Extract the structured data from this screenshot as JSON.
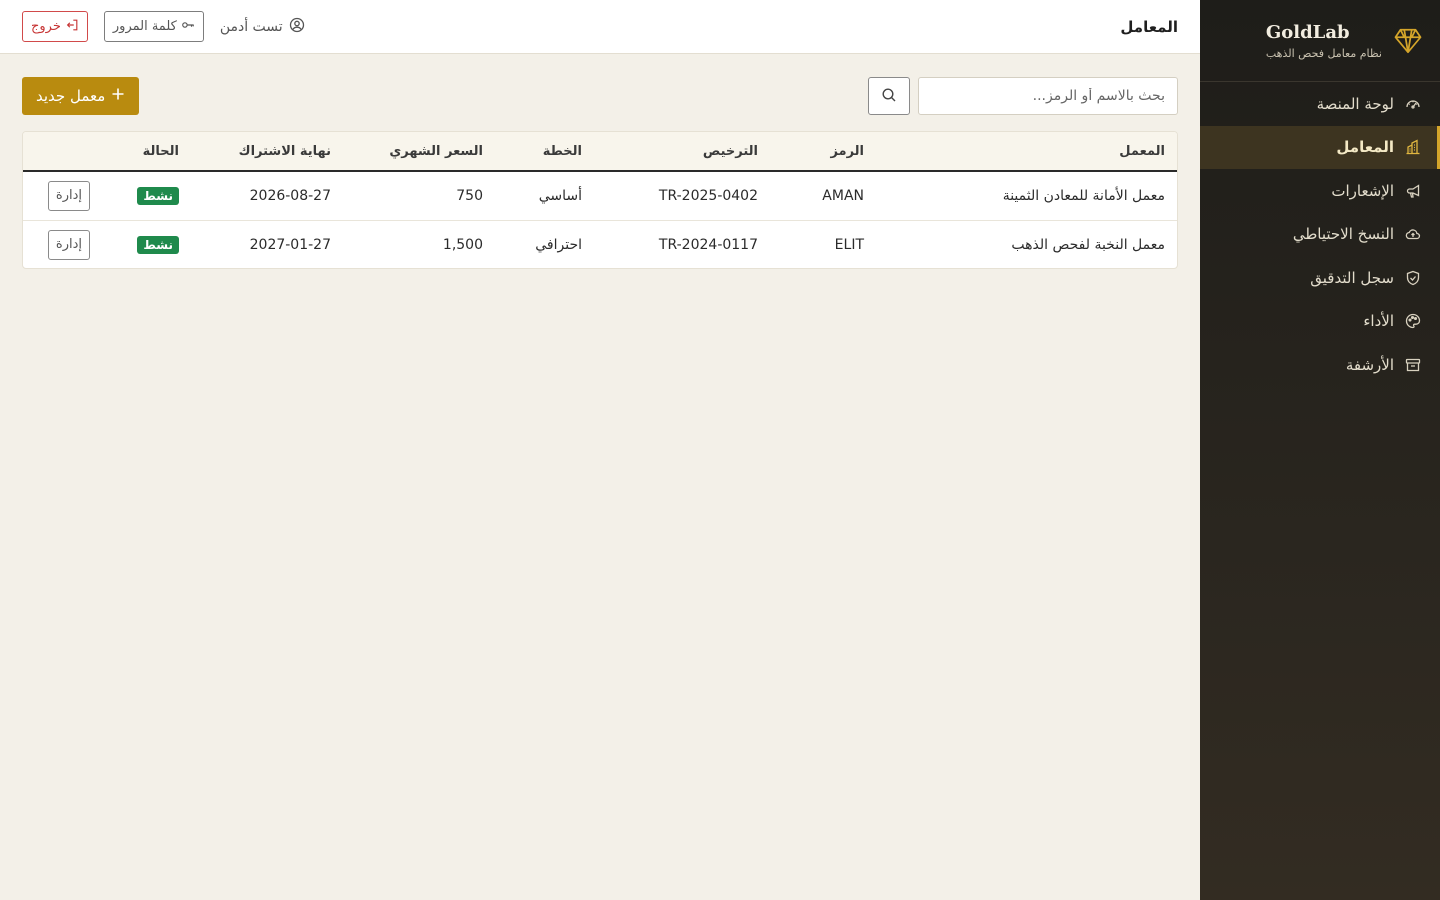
{
  "brand": {
    "name": "GoldLab",
    "subtitle": "نظام معامل فحص الذهب"
  },
  "sidebar": {
    "items": [
      {
        "label": "لوحة المنصة",
        "icon": "dashboard-icon",
        "active": false
      },
      {
        "label": "المعامل",
        "icon": "building-icon",
        "active": true
      },
      {
        "label": "الإشعارات",
        "icon": "megaphone-icon",
        "active": false
      },
      {
        "label": "النسخ الاحتياطي",
        "icon": "cloud-upload-icon",
        "active": false
      },
      {
        "label": "سجل التدقيق",
        "icon": "shield-check-icon",
        "active": false
      },
      {
        "label": "الأداء",
        "icon": "palette-icon",
        "active": false
      },
      {
        "label": "الأرشفة",
        "icon": "archive-icon",
        "active": false
      }
    ]
  },
  "header": {
    "title": "المعامل",
    "user_name": "تست أدمن",
    "password_label": "كلمة المرور",
    "logout_label": "خروج"
  },
  "toolbar": {
    "search_placeholder": "بحث بالاسم أو الرمز...",
    "new_lab_label": "معمل جديد"
  },
  "table": {
    "columns": [
      "المعمل",
      "الرمز",
      "الترخيص",
      "الخطة",
      "السعر الشهري",
      "نهاية الاشتراك",
      "الحالة",
      ""
    ],
    "rows": [
      {
        "name": "معمل الأمانة للمعادن الثمينة",
        "code": "AMAN",
        "license": "TR-2025-0402",
        "plan": "أساسي",
        "price": "750",
        "end": "2026-08-27",
        "status": "نشط",
        "action": "إدارة"
      },
      {
        "name": "معمل النخبة لفحص الذهب",
        "code": "ELIT",
        "license": "TR-2024-0117",
        "plan": "احترافي",
        "price": "1,500",
        "end": "2027-01-27",
        "status": "نشط",
        "action": "إدارة"
      }
    ]
  },
  "colors": {
    "accent": "#b98b0f",
    "status_active": "#1f8a4c",
    "sidebar_bg": "#1e1d19",
    "logout": "#c73535"
  }
}
